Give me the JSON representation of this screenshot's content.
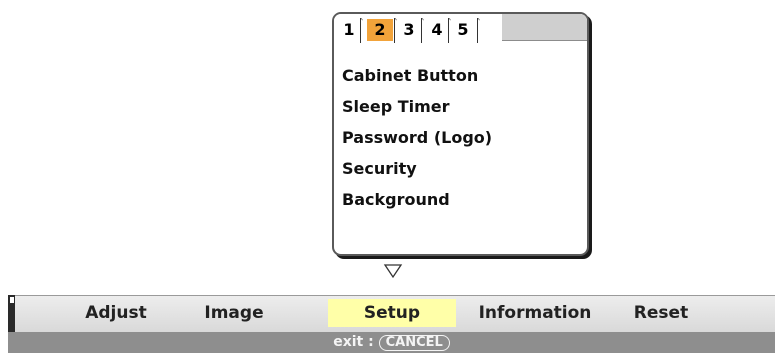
{
  "submenu": {
    "tabs": [
      {
        "label": "1",
        "active": false
      },
      {
        "label": "2",
        "active": true
      },
      {
        "label": "3",
        "active": false
      },
      {
        "label": "4",
        "active": false
      },
      {
        "label": "5",
        "active": false
      }
    ],
    "items": [
      {
        "label": "Cabinet Button"
      },
      {
        "label": "Sleep Timer"
      },
      {
        "label": "Password (Logo)"
      },
      {
        "label": "Security"
      },
      {
        "label": "Background"
      }
    ],
    "more_indicator": "down-triangle-icon"
  },
  "main_menu": {
    "tabs": [
      {
        "label": "Adjust",
        "selected": false
      },
      {
        "label": "Image",
        "selected": false
      },
      {
        "label": "Setup",
        "selected": true
      },
      {
        "label": "Information",
        "selected": false
      },
      {
        "label": "Reset",
        "selected": false
      }
    ],
    "exit_prefix": "exit : ",
    "exit_key": "CANCEL"
  },
  "colors": {
    "active_tab": "#f2a33a",
    "selected_main_tab": "#ffffa8",
    "menubar_bottom": "#8e8e8e"
  }
}
